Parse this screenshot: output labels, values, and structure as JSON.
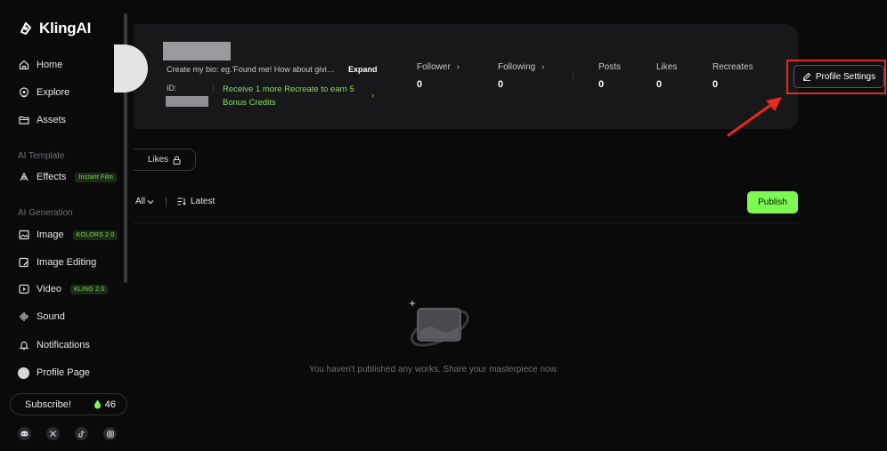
{
  "app": {
    "name": "KlingAI"
  },
  "sidebar": {
    "items": [
      {
        "label": "Home",
        "icon": "home-icon"
      },
      {
        "label": "Explore",
        "icon": "explore-icon"
      },
      {
        "label": "Assets",
        "icon": "folder-icon"
      }
    ],
    "sections": [
      {
        "title": "AI Template",
        "items": [
          {
            "label": "Effects",
            "badge": "Instant Film",
            "icon": "effects-icon"
          }
        ]
      },
      {
        "title": "AI Generation",
        "items": [
          {
            "label": "Image",
            "badge": "KOLORS 2.0",
            "icon": "image-icon"
          },
          {
            "label": "Image Editing",
            "icon": "image-edit-icon"
          },
          {
            "label": "Video",
            "badge": "KLING 2.0",
            "icon": "video-icon"
          },
          {
            "label": "Sound",
            "icon": "sound-icon"
          }
        ]
      }
    ],
    "notifications": "Notifications",
    "profile": "Profile Page",
    "subscribe": "Subscribe!",
    "credits": "46",
    "socials": [
      "discord-icon",
      "x-icon",
      "tiktok-icon",
      "instagram-icon"
    ]
  },
  "profile": {
    "bio": "Create my bio: eg.'Found me! How about givi…",
    "expand": "Expand",
    "id_label": "ID:",
    "promo": "Receive 1 more Recreate to earn 5 Bonus Credits",
    "promo_arrow": "›",
    "stats": [
      {
        "label": "Follower",
        "value": "0",
        "chevron": true
      },
      {
        "label": "Following",
        "value": "0",
        "chevron": true
      },
      {
        "label": "Posts",
        "value": "0"
      },
      {
        "label": "Likes",
        "value": "0"
      },
      {
        "label": "Recreates",
        "value": "0"
      }
    ],
    "settings_button": "Profile Settings"
  },
  "tabs": {
    "likes": "Likes"
  },
  "filters": {
    "all": "All",
    "latest": "Latest"
  },
  "publish": "Publish",
  "empty_state": "You haven't published any works. Share your masterpiece now.",
  "colors": {
    "accent": "#7dfa51",
    "highlight": "#e8291c"
  }
}
